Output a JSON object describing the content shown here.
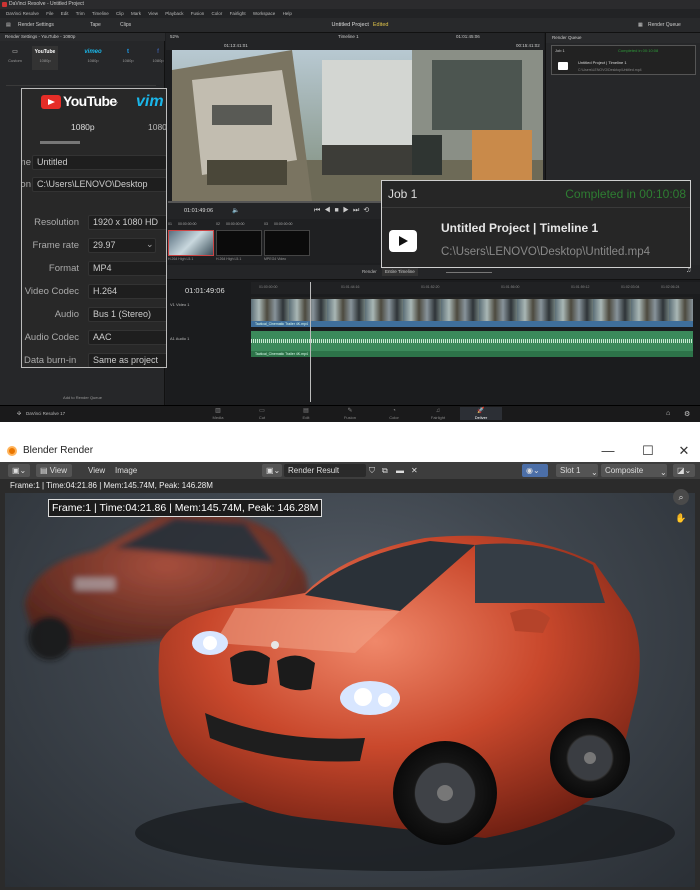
{
  "resolve": {
    "title": "DaVinci Resolve - Untitled Project",
    "menu": [
      "DaVinci Resolve",
      "File",
      "Edit",
      "Trim",
      "Timeline",
      "Clip",
      "Mark",
      "View",
      "Playback",
      "Fusion",
      "Color",
      "Fairlight",
      "Workspace",
      "Help"
    ],
    "toolbar": {
      "render_settings": "Render Settings",
      "tape": "Tape",
      "clips": "Clips",
      "project": "Untitled Project",
      "edited": "Edited",
      "timeline": "Timeline 1",
      "render_queue": "Render Queue"
    },
    "left_panel": {
      "header": "Render Settings - YouTube - 1080p",
      "presets": [
        {
          "name": "Custom",
          "logo": "▭"
        },
        {
          "name": "1080p",
          "logo": "YouTube"
        },
        {
          "name": "1080p",
          "logo": "vimeo"
        },
        {
          "name": "1080p",
          "logo": "t"
        },
        {
          "name": "1080p",
          "logo": "f"
        }
      ]
    },
    "zoom_settings": {
      "youtube": "YouTube",
      "vimeo": "vim",
      "res_a": "1080p",
      "res_b": "1080",
      "fields": [
        {
          "label": "me",
          "value": "Untitled"
        },
        {
          "label": "on",
          "value": "C:\\Users\\LENOVO\\Desktop"
        },
        {
          "label": "Resolution",
          "value": "1920 x 1080 HD"
        },
        {
          "label": "Frame rate",
          "value": "29.97"
        },
        {
          "label": "Format",
          "value": "MP4"
        },
        {
          "label": "Video Codec",
          "value": "H.264"
        },
        {
          "label": "Audio",
          "value": "Bus 1 (Stereo)"
        },
        {
          "label": "Audio Codec",
          "value": "AAC"
        },
        {
          "label": "Data burn-in",
          "value": "Same as project"
        }
      ]
    },
    "viewer": {
      "zoom": "52%",
      "timecode": "01:01:49:06",
      "duration": "00:15:41:02",
      "tc_a": "01:01:45:06",
      "tc_b": "01:13:41:01"
    },
    "clips": [
      {
        "id": "01",
        "tc": "00:00:00:00",
        "name": "H.264 High L5.1"
      },
      {
        "id": "02",
        "tc": "00:00:00:00",
        "name": "H.264 High L5.1"
      },
      {
        "id": "03",
        "tc": "00:00:00:00",
        "name": "MPEG4 Video"
      }
    ],
    "timeline": {
      "timecode": "01:01:49:06",
      "render": "Render",
      "render_mode": "Entire Timeline",
      "video_track": "V1  Video 1",
      "audio_track": "A1  Audio 1",
      "clip_label": "Tactical_Cinematic Trailer 4K.mp4",
      "add_queue": "Add to Render Queue",
      "ruler": [
        "01:00:00:00",
        "01:01:44:16",
        "01:01:52:20",
        "01:01:56:00",
        "01:01:59:12",
        "01:02:03:04",
        "01:02:06:24"
      ]
    },
    "render_queue": {
      "header": "Render Queue",
      "job": "Job 1",
      "status_small": "Completed in 00:10:08",
      "name": "Untitled Project | Timeline 1",
      "path": "C:\\Users\\LENOVO\\Desktop\\Untitled.mp4"
    },
    "zoom_job": {
      "job": "Job 1",
      "status": "Completed in 00:10:08",
      "name": "Untitled Project | Timeline 1",
      "path": "C:\\Users\\LENOVO\\Desktop\\Untitled.mp4"
    },
    "pages": [
      "Media",
      "Cut",
      "Edit",
      "Fusion",
      "Color",
      "Fairlight",
      "Deliver"
    ],
    "version": "DaVinci Resolve 17"
  },
  "blender": {
    "title": "Blender Render",
    "controls": {
      "minimize": "—",
      "maximize": "☐",
      "close": "✕"
    },
    "menus": [
      "View",
      "View",
      "Image"
    ],
    "image_name": "Render Result",
    "slot": "Slot 1",
    "pass": "Composite",
    "info": "Frame:1 | Time:04:21.86 | Mem:145.74M, Peak: 146.28M",
    "stamp": "Frame:1 | Time:04:21.86 | Mem:145.74M, Peak: 146.28M"
  },
  "colors": {
    "resolve_bg": "#1d1e20",
    "youtube_red": "#e52d27",
    "vimeo_blue": "#1ab7ea",
    "completed_green": "#2e7d32",
    "blender_orange": "#ea7600",
    "car_red": "#c9482c"
  }
}
